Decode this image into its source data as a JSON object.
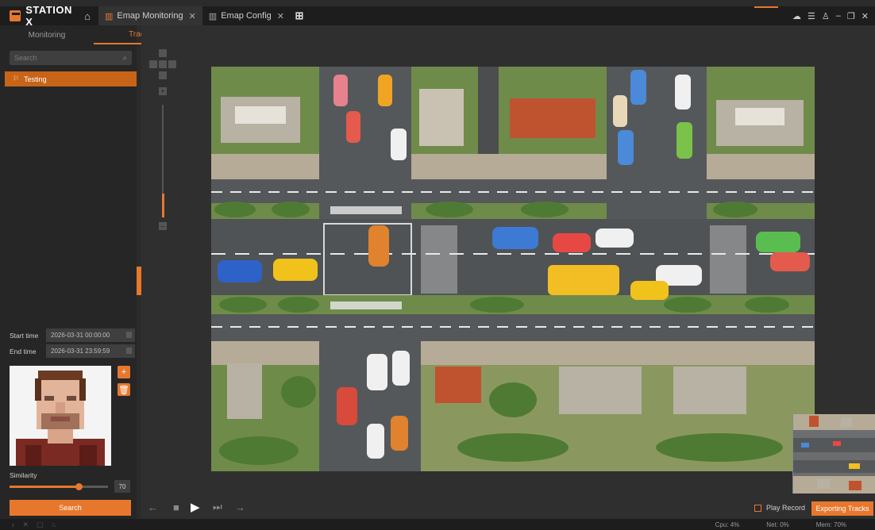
{
  "app": {
    "name": "STATION X",
    "tabs": [
      {
        "label": "Emap Monitoring",
        "active": true
      },
      {
        "label": "Emap Config",
        "active": false
      }
    ],
    "window_controls": [
      "cloud-icon",
      "document-icon",
      "user-icon",
      "minimize-icon",
      "restore-icon",
      "close-icon"
    ]
  },
  "sidebar": {
    "tabs": [
      {
        "label": "Monitoring",
        "active": false
      },
      {
        "label": "Tracks",
        "active": true
      }
    ],
    "search_placeholder": "Search",
    "items": [
      {
        "label": "Testing",
        "selected": true
      }
    ],
    "start_time_label": "Start time",
    "start_time_value": "2026-03-31 00:00:00",
    "end_time_label": "End time",
    "end_time_value": "2026-03-31 23:59:59",
    "similarity_label": "Similarity",
    "similarity_value": "70",
    "similarity_level": 0.7,
    "search_button": "Search"
  },
  "playback": {
    "play_record_label": "Play Record",
    "export_button": "Exporting Tracks"
  },
  "status": {
    "cpu": "Cpu: 4%",
    "net": "Net: 0%",
    "mem": "Mem: 70%"
  },
  "colors": {
    "accent": "#e8772e",
    "background": "#2b2b2b",
    "panel": "#262626"
  }
}
